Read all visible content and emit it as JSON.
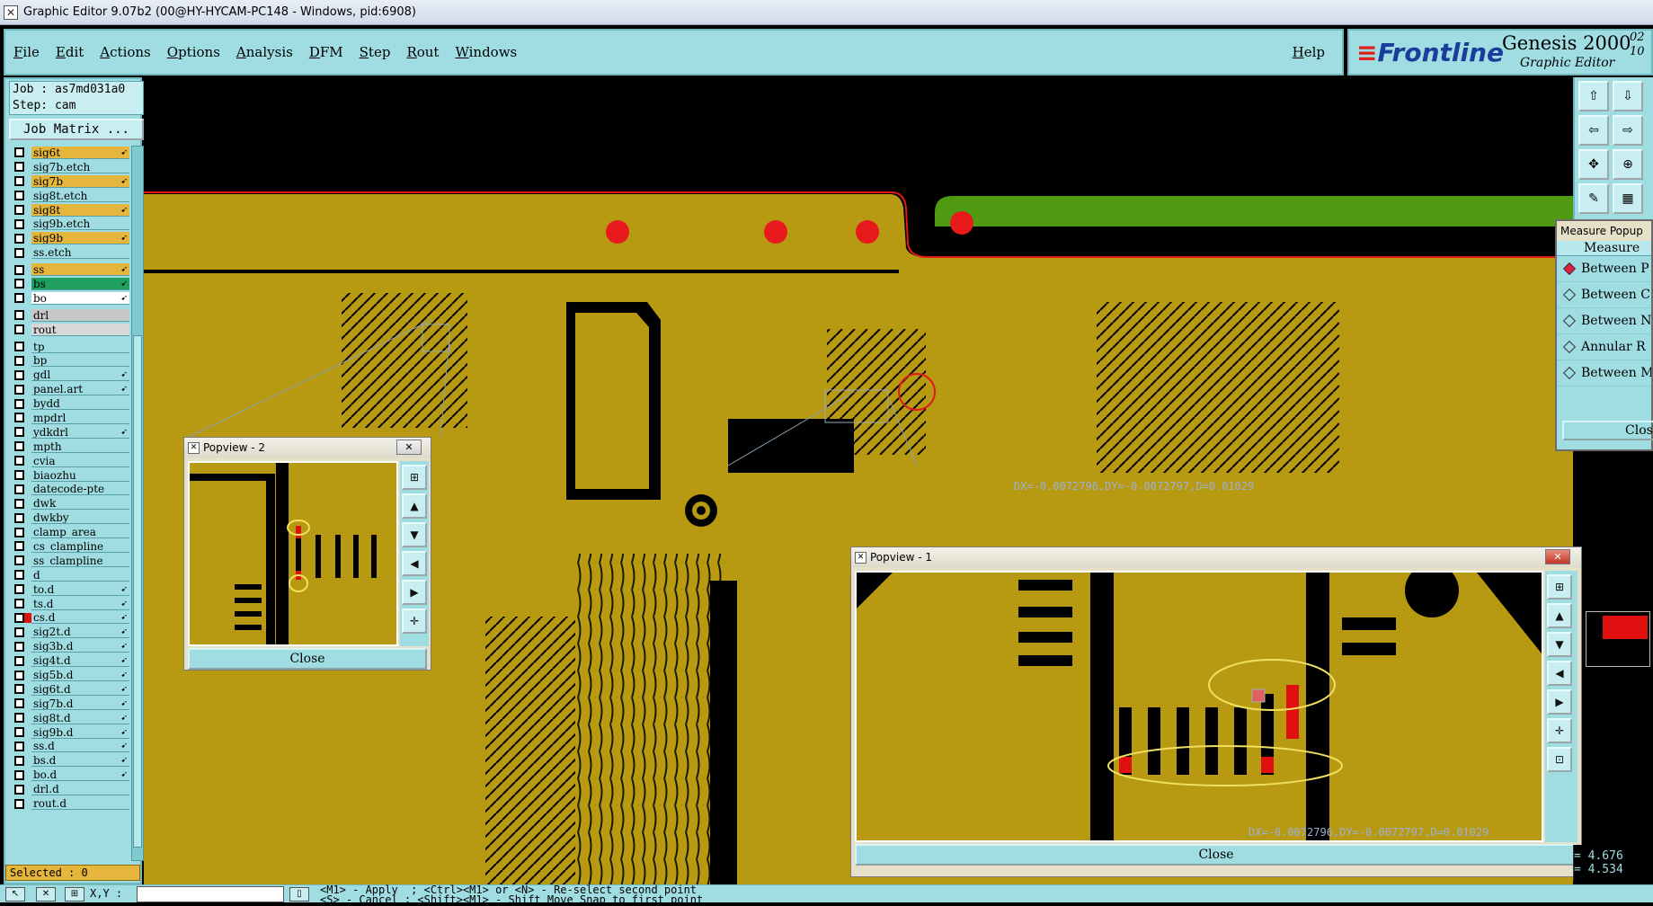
{
  "window": {
    "title": "Graphic Editor 9.07b2 (00@HY-HYCAM-PC148 - Windows, pid:6908)"
  },
  "menu": {
    "items": [
      "File",
      "Edit",
      "Actions",
      "Options",
      "Analysis",
      "DFM",
      "Step",
      "Rout",
      "Windows"
    ],
    "help": "Help"
  },
  "brand": {
    "logo": "Frontline",
    "product": "Genesis 2000",
    "subtitle": "Graphic Editor",
    "date_line1": "02",
    "date_line2": "10"
  },
  "job": {
    "job_line": "Job : as7md031a0",
    "step_line": "Step: cam",
    "matrix_button": "Job Matrix ..."
  },
  "layers": [
    {
      "name": "sig6t",
      "color": "#e6b53c",
      "arrow": true
    },
    {
      "name": "sig7b.etch",
      "color": "#9fdde2",
      "arrow": false
    },
    {
      "name": "sig7b",
      "color": "#e6b53c",
      "arrow": true
    },
    {
      "name": "sig8t.etch",
      "color": "#9fdde2",
      "arrow": false
    },
    {
      "name": "sig8t",
      "color": "#e6b53c",
      "arrow": true
    },
    {
      "name": "sig9b.etch",
      "color": "#9fdde2",
      "arrow": false
    },
    {
      "name": "sig9b",
      "color": "#e6b53c",
      "arrow": true
    },
    {
      "name": "ss.etch",
      "color": "#9fdde2",
      "arrow": false
    },
    {
      "name": "ss",
      "color": "#e6b53c",
      "arrow": true,
      "sep": true
    },
    {
      "name": "bs",
      "color": "#1fa060",
      "arrow": true
    },
    {
      "name": "bo",
      "color": "#ffffff",
      "arrow": true
    },
    {
      "name": "drl",
      "color": "#c8c8c8",
      "arrow": false,
      "sep": true
    },
    {
      "name": "rout",
      "color": "#d8d8d8",
      "arrow": false
    },
    {
      "name": "tp",
      "color": "#9fdde2",
      "arrow": false,
      "sep": true
    },
    {
      "name": "bp",
      "color": "#9fdde2",
      "arrow": false
    },
    {
      "name": "gdl",
      "color": "#9fdde2",
      "arrow": true
    },
    {
      "name": "panel.art",
      "color": "#9fdde2",
      "arrow": true
    },
    {
      "name": "bydd",
      "color": "#9fdde2",
      "arrow": false
    },
    {
      "name": "mpdrl",
      "color": "#9fdde2",
      "arrow": false
    },
    {
      "name": "ydkdrl",
      "color": "#9fdde2",
      "arrow": true
    },
    {
      "name": "mpth",
      "color": "#9fdde2",
      "arrow": false
    },
    {
      "name": "cvia",
      "color": "#9fdde2",
      "arrow": false
    },
    {
      "name": "biaozhu",
      "color": "#9fdde2",
      "arrow": false
    },
    {
      "name": "datecode-pte",
      "color": "#9fdde2",
      "arrow": false
    },
    {
      "name": "dwk",
      "color": "#9fdde2",
      "arrow": false
    },
    {
      "name": "dwkby",
      "color": "#9fdde2",
      "arrow": false
    },
    {
      "name": "clamp_area",
      "color": "#9fdde2",
      "arrow": false
    },
    {
      "name": "cs_clampline",
      "color": "#9fdde2",
      "arrow": false
    },
    {
      "name": "ss_clampline",
      "color": "#9fdde2",
      "arrow": false
    },
    {
      "name": "d",
      "color": "#9fdde2",
      "arrow": false
    },
    {
      "name": "to.d",
      "color": "#9fdde2",
      "arrow": true
    },
    {
      "name": "ts.d",
      "color": "#9fdde2",
      "arrow": true
    },
    {
      "name": "cs.d",
      "color": "#9fdde2",
      "arrow": true,
      "marker": true
    },
    {
      "name": "sig2t.d",
      "color": "#9fdde2",
      "arrow": true
    },
    {
      "name": "sig3b.d",
      "color": "#9fdde2",
      "arrow": true
    },
    {
      "name": "sig4t.d",
      "color": "#9fdde2",
      "arrow": true
    },
    {
      "name": "sig5b.d",
      "color": "#9fdde2",
      "arrow": true
    },
    {
      "name": "sig6t.d",
      "color": "#9fdde2",
      "arrow": true
    },
    {
      "name": "sig7b.d",
      "color": "#9fdde2",
      "arrow": true
    },
    {
      "name": "sig8t.d",
      "color": "#9fdde2",
      "arrow": true
    },
    {
      "name": "sig9b.d",
      "color": "#9fdde2",
      "arrow": true
    },
    {
      "name": "ss.d",
      "color": "#9fdde2",
      "arrow": true
    },
    {
      "name": "bs.d",
      "color": "#9fdde2",
      "arrow": true
    },
    {
      "name": "bo.d",
      "color": "#9fdde2",
      "arrow": true
    },
    {
      "name": "drl.d",
      "color": "#9fdde2",
      "arrow": false
    },
    {
      "name": "rout.d",
      "color": "#9fdde2",
      "arrow": false
    }
  ],
  "status": {
    "selected": "Selected : 0"
  },
  "canvas": {
    "measure_text": "DX=-0.0072796,DY=-0.0072797,D=0.01029"
  },
  "popview2": {
    "title": "Popview - 2",
    "close_x": "✕",
    "close_button": "Close"
  },
  "popview1": {
    "title": "Popview - 1",
    "close_x": "✕",
    "close_button": "Close",
    "measure_text": "DX=-0.0072796,DY=-0.0072797,D=0.01029"
  },
  "measure_popup": {
    "title": "Measure Popup",
    "heading": "Measure",
    "options": [
      "Between P",
      "Between C",
      "Between N",
      "Annular R",
      "Between M"
    ],
    "selected_index": 0,
    "close": "Close"
  },
  "coords": {
    "x": "= 4.676",
    "y": "= 4.534"
  },
  "bottom": {
    "xy_label": "X,Y :",
    "message_line1": "<M1> - Apply  ; <Ctrl><M1> or <N> - Re-select second point",
    "message_line2": "<S> - Cancel ; <Shift><M1> - Shift Move Snap to first point"
  },
  "colors": {
    "board": "#b89a12",
    "panel": "#9fdde2",
    "pad_red": "#e8191a",
    "green_plane": "#4f9a10",
    "outline_red": "#e01818"
  }
}
